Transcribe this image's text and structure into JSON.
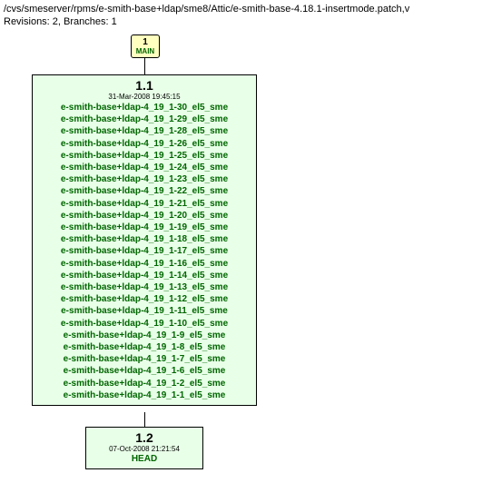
{
  "path": "/cvs/smeserver/rpms/e-smith-base+ldap/sme8/Attic/e-smith-base-4.18.1-insertmode.patch,v",
  "revisions_line": "Revisions: 2, Branches: 1",
  "branch_main": {
    "num": "1",
    "label": "MAIN"
  },
  "rev11": {
    "version": "1.1",
    "date": "31-Mar-2008 19:45:15",
    "tags": [
      "e-smith-base+ldap-4_19_1-30_el5_sme",
      "e-smith-base+ldap-4_19_1-29_el5_sme",
      "e-smith-base+ldap-4_19_1-28_el5_sme",
      "e-smith-base+ldap-4_19_1-26_el5_sme",
      "e-smith-base+ldap-4_19_1-25_el5_sme",
      "e-smith-base+ldap-4_19_1-24_el5_sme",
      "e-smith-base+ldap-4_19_1-23_el5_sme",
      "e-smith-base+ldap-4_19_1-22_el5_sme",
      "e-smith-base+ldap-4_19_1-21_el5_sme",
      "e-smith-base+ldap-4_19_1-20_el5_sme",
      "e-smith-base+ldap-4_19_1-19_el5_sme",
      "e-smith-base+ldap-4_19_1-18_el5_sme",
      "e-smith-base+ldap-4_19_1-17_el5_sme",
      "e-smith-base+ldap-4_19_1-16_el5_sme",
      "e-smith-base+ldap-4_19_1-14_el5_sme",
      "e-smith-base+ldap-4_19_1-13_el5_sme",
      "e-smith-base+ldap-4_19_1-12_el5_sme",
      "e-smith-base+ldap-4_19_1-11_el5_sme",
      "e-smith-base+ldap-4_19_1-10_el5_sme",
      "e-smith-base+ldap-4_19_1-9_el5_sme",
      "e-smith-base+ldap-4_19_1-8_el5_sme",
      "e-smith-base+ldap-4_19_1-7_el5_sme",
      "e-smith-base+ldap-4_19_1-6_el5_sme",
      "e-smith-base+ldap-4_19_1-2_el5_sme",
      "e-smith-base+ldap-4_19_1-1_el5_sme"
    ]
  },
  "rev12": {
    "version": "1.2",
    "date": "07-Oct-2008 21:21:54",
    "tag": "HEAD"
  }
}
